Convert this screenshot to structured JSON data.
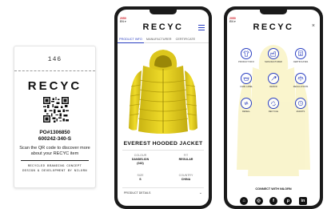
{
  "tag": {
    "number": "146",
    "logo": "RECYC",
    "po": "PO#1306850",
    "sku": "600242-340-S",
    "scan_text": "Scan the QR code to discover more about your RECYC item",
    "footer_line1": "RECYCLED BRANDING CONCEPT",
    "footer_line2": "DESIGN & DEVELOPMENT BY NILORN"
  },
  "product_screen": {
    "lang_top": "2050",
    "lang_bottom": "EN ▾",
    "logo": "RECYC",
    "tabs": [
      "PRODUCT INFO",
      "MANUFACTURER",
      "CERTIFICATE"
    ],
    "active_tab": 0,
    "product_name": "EVEREST HOODED JACKET",
    "attributes": [
      {
        "label": "COLOUR",
        "value": "DANDELION",
        "extra": "(040)"
      },
      {
        "label": "FIT",
        "value": "REGULAR",
        "extra": ""
      },
      {
        "label": "SIZE",
        "value": "S",
        "extra": ""
      },
      {
        "label": "COUNTRY",
        "value": "CHINA",
        "extra": ""
      }
    ],
    "details_label": "PRODUCT DETAILS",
    "details_chevron": "⌄"
  },
  "menu_screen": {
    "lang_top": "2050",
    "lang_bottom": "EN ▾",
    "logo": "RECYC",
    "close": "×",
    "items": [
      {
        "label": "PRODUCT INFO",
        "icon": "shirt-icon"
      },
      {
        "label": "MANUFACTURER",
        "icon": "factory-icon"
      },
      {
        "label": "CERTIFICATES",
        "icon": "certificate-icon"
      },
      {
        "label": "CARE LABEL",
        "icon": "care-label-icon"
      },
      {
        "label": "REPAIR",
        "icon": "repair-icon"
      },
      {
        "label": "REGULATIONS",
        "icon": "regulations-icon"
      },
      {
        "label": "RESELL",
        "icon": "resell-icon"
      },
      {
        "label": "RECYCLE",
        "icon": "recycle-icon"
      },
      {
        "label": "EVENTS",
        "icon": "events-icon"
      }
    ],
    "connect_label": "CONNECT WITH NILORN",
    "socials": [
      {
        "icon": "home-icon",
        "glyph": "⌂"
      },
      {
        "icon": "instagram-icon",
        "glyph": "◎"
      },
      {
        "icon": "facebook-icon",
        "glyph": "f"
      },
      {
        "icon": "pinterest-icon",
        "glyph": "p"
      },
      {
        "icon": "linkedin-icon",
        "glyph": "in"
      }
    ]
  },
  "colors": {
    "accent": "#2a3fc1",
    "jacket": "#e8d21f",
    "lang_red": "#d0202a"
  }
}
